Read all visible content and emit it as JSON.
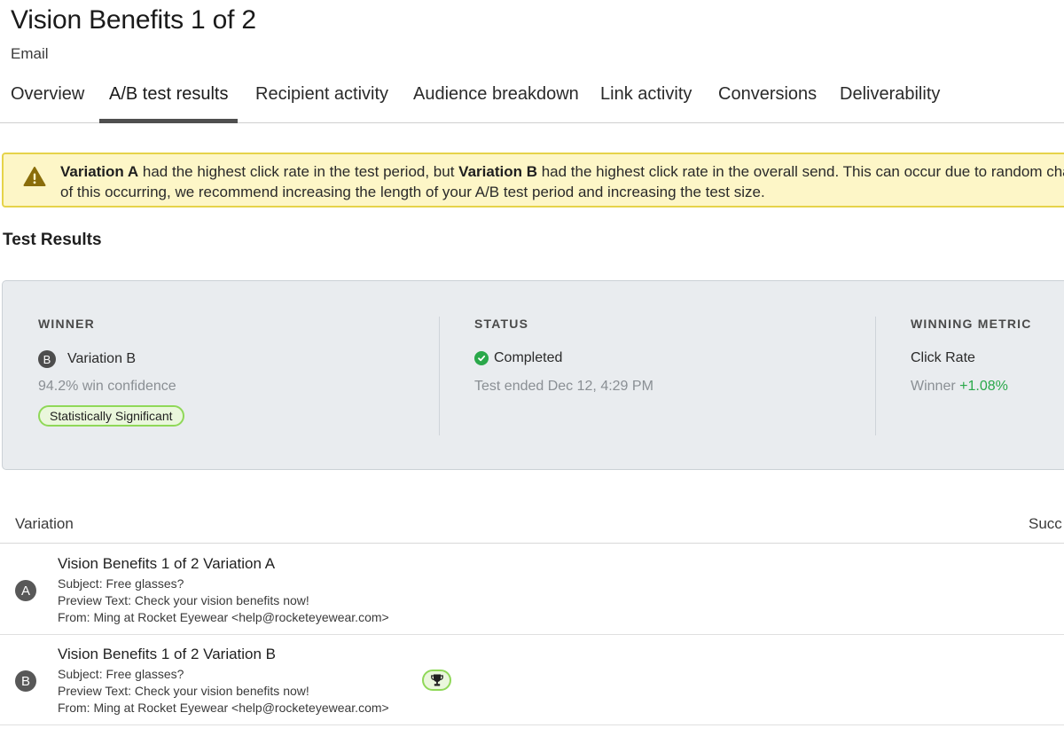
{
  "header": {
    "title": "Vision Benefits 1 of 2",
    "subtitle": "Email"
  },
  "tabs": [
    {
      "label": "Overview",
      "active": false
    },
    {
      "label": "A/B test results",
      "active": true
    },
    {
      "label": "Recipient activity",
      "active": false
    },
    {
      "label": "Audience breakdown",
      "active": false
    },
    {
      "label": "Link activity",
      "active": false
    },
    {
      "label": "Conversions",
      "active": false
    },
    {
      "label": "Deliverability",
      "active": false
    }
  ],
  "alert": {
    "icon": "warning-icon",
    "bold_a": "Variation A",
    "text_1": " had the highest click rate in the test period, but ",
    "bold_b": "Variation B",
    "text_2": " had the highest click rate in the overall send. This can occur due to random chance",
    "line_2": "of this occurring, we recommend increasing the length of your A/B test period and increasing the test size."
  },
  "test_results": {
    "title": "Test Results",
    "winner": {
      "label": "WINNER",
      "badge": "B",
      "name": "Variation B",
      "confidence": "94.2% win confidence",
      "significance": "Statistically Significant"
    },
    "status": {
      "label": "STATUS",
      "value": "Completed",
      "ended": "Test ended Dec 12, 4:29 PM"
    },
    "metric": {
      "label": "WINNING METRIC",
      "value": "Click Rate",
      "winner_prefix": "Winner ",
      "winner_delta": "+1.08%"
    }
  },
  "table": {
    "col_variation": "Variation",
    "col_success": "Succ",
    "rows": [
      {
        "badge": "A",
        "name": "Vision Benefits 1 of 2 Variation A",
        "subject": "Subject: Free glasses?",
        "preview": "Preview Text: Check your vision benefits now!",
        "from": "From: Ming at Rocket Eyewear <help@rocketeyewear.com>",
        "winner": false
      },
      {
        "badge": "B",
        "name": "Vision Benefits 1 of 2 Variation B",
        "subject": "Subject: Free glasses?",
        "preview": "Preview Text: Check your vision benefits now!",
        "from": "From: Ming at Rocket Eyewear <help@rocketeyewear.com>",
        "winner": true,
        "winner_icon": "trophy-icon"
      }
    ]
  },
  "colors": {
    "alert_bg": "#fdf6c7",
    "alert_border": "#e6d34a",
    "success_green": "#2aa84a",
    "badge_green": "#8fd858"
  }
}
